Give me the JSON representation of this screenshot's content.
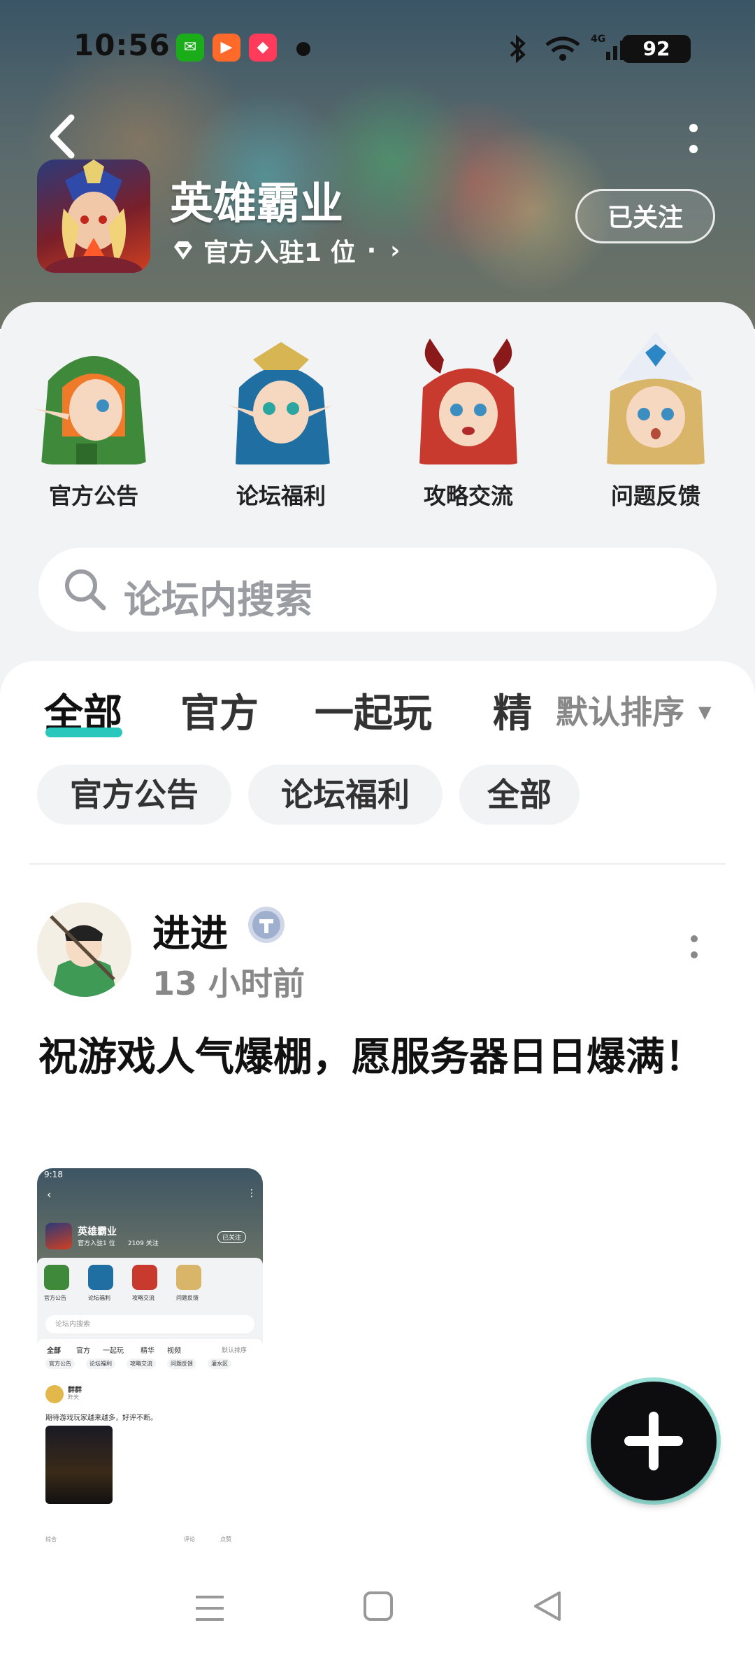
{
  "status_bar": {
    "time": "10:56",
    "battery": "92"
  },
  "header": {
    "game_name": "英雄霸业",
    "official_text": "官方入驻1 位",
    "official_sep": "·",
    "follow_label": "已关注"
  },
  "categories": [
    {
      "label": "官方公告",
      "color": "#3f8a3a"
    },
    {
      "label": "论坛福利",
      "color": "#1f6fa3"
    },
    {
      "label": "攻略交流",
      "color": "#c83a2e"
    },
    {
      "label": "问题反馈",
      "color": "#d9b56a"
    }
  ],
  "search": {
    "placeholder": "论坛内搜索"
  },
  "tabs": [
    "全部",
    "官方",
    "一起玩",
    "精"
  ],
  "sort_label": "默认排序",
  "chips": [
    "官方公告",
    "论坛福利",
    "全部"
  ],
  "post": {
    "username": "进进",
    "time": "13 小时前",
    "title": "祝游戏人气爆棚，愿服务器日日爆满！"
  },
  "thumbnail": {
    "time": "9:18",
    "game_name": "英雄霸业",
    "official": "官方入驻1 位",
    "followers": "2109 关注",
    "follow_label": "已关注",
    "categories": [
      "官方公告",
      "论坛福利",
      "攻略交流",
      "问题反馈"
    ],
    "search": "论坛内搜索",
    "tabs": [
      "全部",
      "官方",
      "一起玩",
      "精华",
      "视频"
    ],
    "sort": "默认排序",
    "chips": [
      "官方公告",
      "论坛福利",
      "攻略交流",
      "问题反馈",
      "灌水区"
    ],
    "user": "群群",
    "user_time": "昨天",
    "post_text": "期待游戏玩家越来越多，好评不断。",
    "footer_left": "综合",
    "footer_comment": "评论",
    "footer_like": "点赞"
  },
  "accent": "#2ac7bd"
}
